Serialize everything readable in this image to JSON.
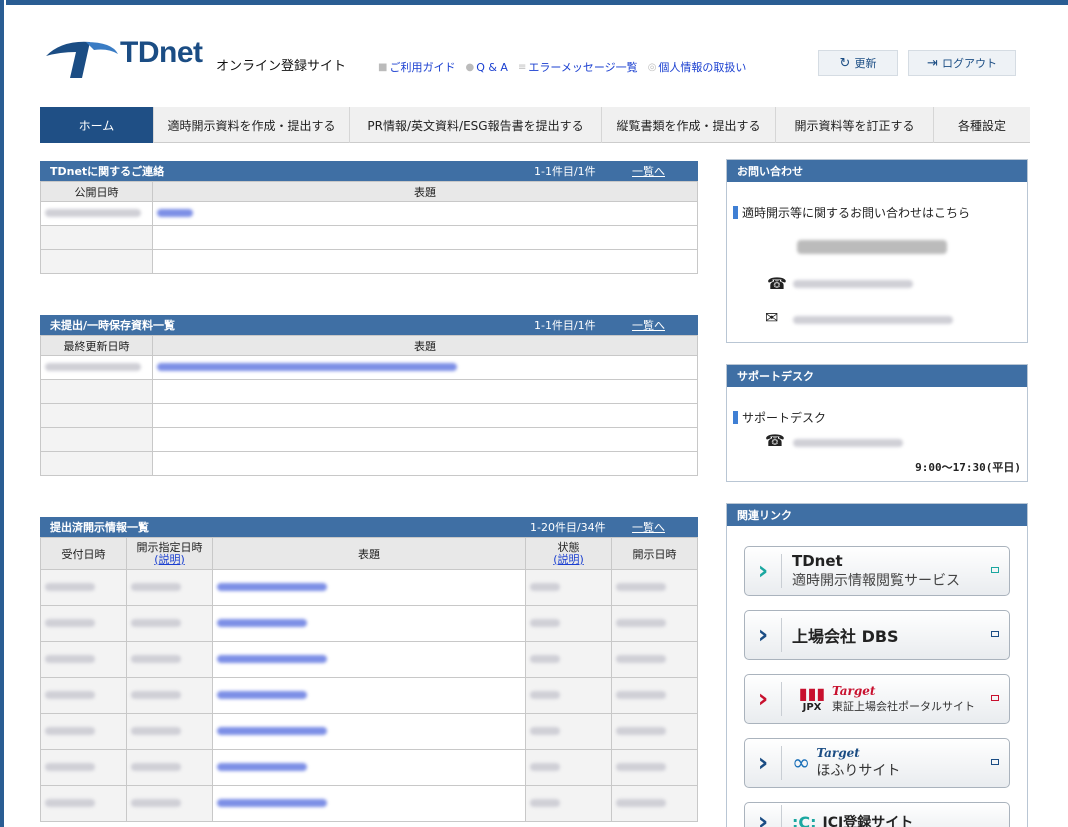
{
  "header": {
    "logo_text": "TDnet",
    "site_name": "オンライン登録サイト",
    "links": [
      "ご利用ガイド",
      "Q & A",
      "エラーメッセージ一覧",
      "個人情報の取扱い"
    ],
    "refresh_label": "更新",
    "logout_label": "ログアウト"
  },
  "nav": {
    "items": [
      "ホーム",
      "適時開示資料を作成・提出する",
      "PR情報/英文資料/ESG報告書を提出する",
      "縦覧書類を作成・提出する",
      "開示資料等を訂正する",
      "各種設定"
    ]
  },
  "notices": {
    "title": "TDnetに関するご連絡",
    "count": "1-1件目/1件",
    "more": "一覧へ",
    "col_date": "公開日時",
    "col_title": "表題"
  },
  "drafts": {
    "title": "未提出/一時保存資料一覧",
    "count": "1-1件目/1件",
    "more": "一覧へ",
    "col_date": "最終更新日時",
    "col_title": "表題"
  },
  "submitted": {
    "title": "提出済開示情報一覧",
    "count": "1-20件目/34件",
    "more": "一覧へ",
    "col_received": "受付日時",
    "col_scheduled": "開示指定日時",
    "col_scheduled_note": "(説明)",
    "col_title": "表題",
    "col_status": "状態",
    "col_status_note": "(説明)",
    "col_disclosed": "開示日時"
  },
  "contact": {
    "title": "お問い合わせ",
    "label": "適時開示等に関するお問い合わせはこちら"
  },
  "support": {
    "title": "サポートデスク",
    "label": "サポートデスク",
    "hours": "9:00～17:30(平日)"
  },
  "links": {
    "title": "関連リンク",
    "tdnet_title": "TDnet",
    "tdnet_sub": "適時開示情報閲覧サービス",
    "dbs": "上場会社 DBS",
    "jpx_brand": "JPX",
    "target": "Target",
    "portal": "東証上場会社ポータルサイト",
    "hofuri": "ほふりサイト",
    "icj": "ICJ登録サイト"
  },
  "colors": {
    "primary": "#1f4f85",
    "panel_head": "#3f6fa4",
    "link": "#1a3fd0"
  }
}
